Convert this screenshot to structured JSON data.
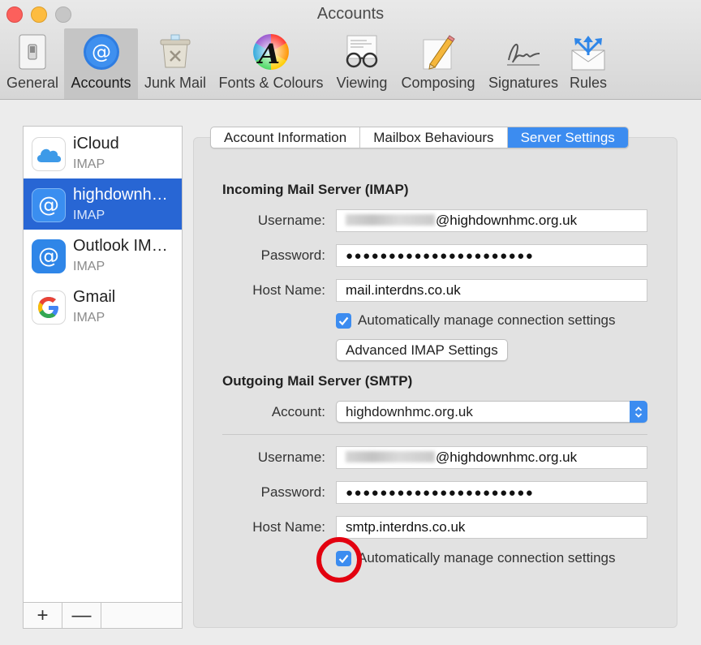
{
  "window": {
    "title": "Accounts",
    "traffic_lights": {
      "close": "#fc605c",
      "minimize": "#fdbc40",
      "maximize": "#c6c6c6"
    }
  },
  "toolbar": {
    "items": [
      {
        "label": "General",
        "icon": "general-switch-icon"
      },
      {
        "label": "Accounts",
        "icon": "at-sign-icon",
        "active": true
      },
      {
        "label": "Junk Mail",
        "icon": "junk-bin-icon"
      },
      {
        "label": "Fonts & Colours",
        "icon": "font-colour-wheel-icon"
      },
      {
        "label": "Viewing",
        "icon": "glasses-icon"
      },
      {
        "label": "Composing",
        "icon": "pencil-paper-icon"
      },
      {
        "label": "Signatures",
        "icon": "signature-icon"
      },
      {
        "label": "Rules",
        "icon": "rules-envelope-icon"
      }
    ]
  },
  "sidebar": {
    "accounts": [
      {
        "name": "iCloud",
        "type": "IMAP",
        "icon": "icloud-icon"
      },
      {
        "name": "highdownh…",
        "type": "IMAP",
        "icon": "at-sign-icon",
        "selected": true
      },
      {
        "name": "Outlook IM…",
        "type": "IMAP",
        "icon": "at-sign-icon"
      },
      {
        "name": "Gmail",
        "type": "IMAP",
        "icon": "google-icon"
      }
    ],
    "add_label": "+",
    "remove_label": "—"
  },
  "tabs": [
    {
      "label": "Account Information"
    },
    {
      "label": "Mailbox Behaviours"
    },
    {
      "label": "Server Settings",
      "active": true
    }
  ],
  "incoming": {
    "title": "Incoming Mail Server (IMAP)",
    "username_label": "Username:",
    "username_domain": "@highdownhmc.org.uk",
    "password_label": "Password:",
    "password_mask": "●●●●●●●●●●●●●●●●●●●●●●",
    "host_label": "Host Name:",
    "host_value": "mail.interdns.co.uk",
    "auto_manage_label": "Automatically manage connection settings",
    "auto_manage_checked": true,
    "advanced_button": "Advanced IMAP Settings"
  },
  "outgoing": {
    "title": "Outgoing Mail Server (SMTP)",
    "account_label": "Account:",
    "account_value": "highdownhmc.org.uk",
    "username_label": "Username:",
    "username_domain": "@highdownhmc.org.uk",
    "password_label": "Password:",
    "password_mask": "●●●●●●●●●●●●●●●●●●●●●●",
    "host_label": "Host Name:",
    "host_value": "smtp.interdns.co.uk",
    "auto_manage_label": "Automatically manage connection settings",
    "auto_manage_checked": true
  },
  "colors": {
    "accent": "#3c8cf0",
    "selection": "#2866d4",
    "annotation_circle": "#e3000f"
  }
}
